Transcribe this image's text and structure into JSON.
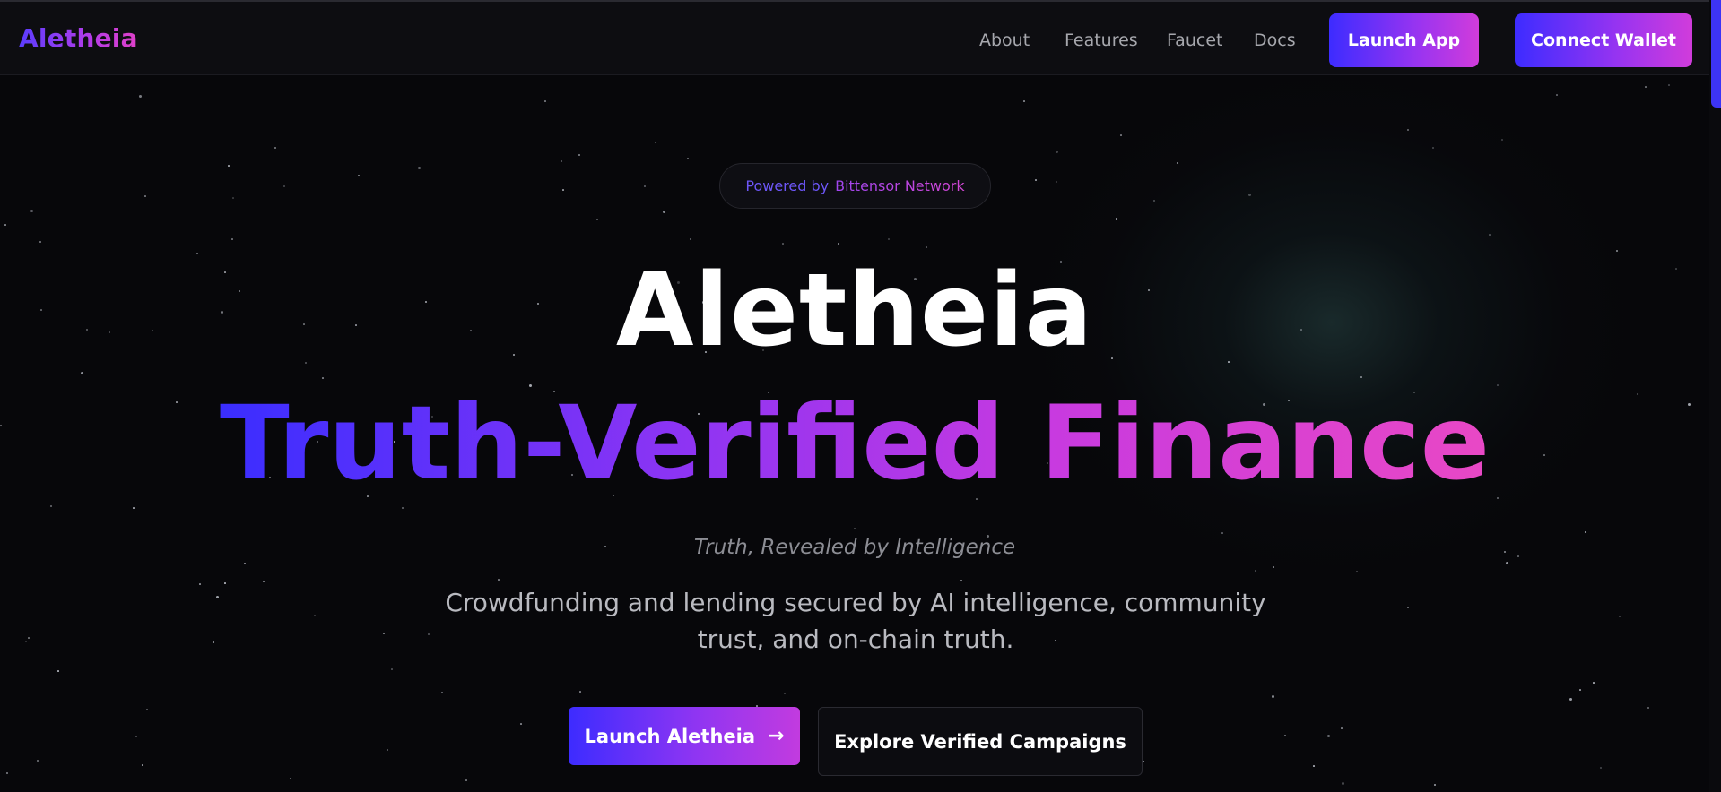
{
  "nav": {
    "logo": "Aletheia",
    "links": [
      "About",
      "Features",
      "Faucet",
      "Docs"
    ],
    "launch_app": "Launch App",
    "connect_wallet": "Connect Wallet"
  },
  "hero": {
    "badge_prefix": "Powered by",
    "badge_name": "Bittensor Network",
    "title": "Aletheia",
    "subtitle": "Truth-Verified Finance",
    "tagline": "Truth, Revealed by Intelligence",
    "description": "Crowdfunding and lending secured by AI intelligence, community trust, and on-chain truth.",
    "cta_primary": "Launch Aletheia",
    "cta_primary_icon": "arrow-right-icon",
    "cta_secondary": "Explore Verified Campaigns"
  },
  "colors": {
    "background": "#07070a",
    "accent_start": "#3d2cff",
    "accent_end": "#d13cdb"
  }
}
